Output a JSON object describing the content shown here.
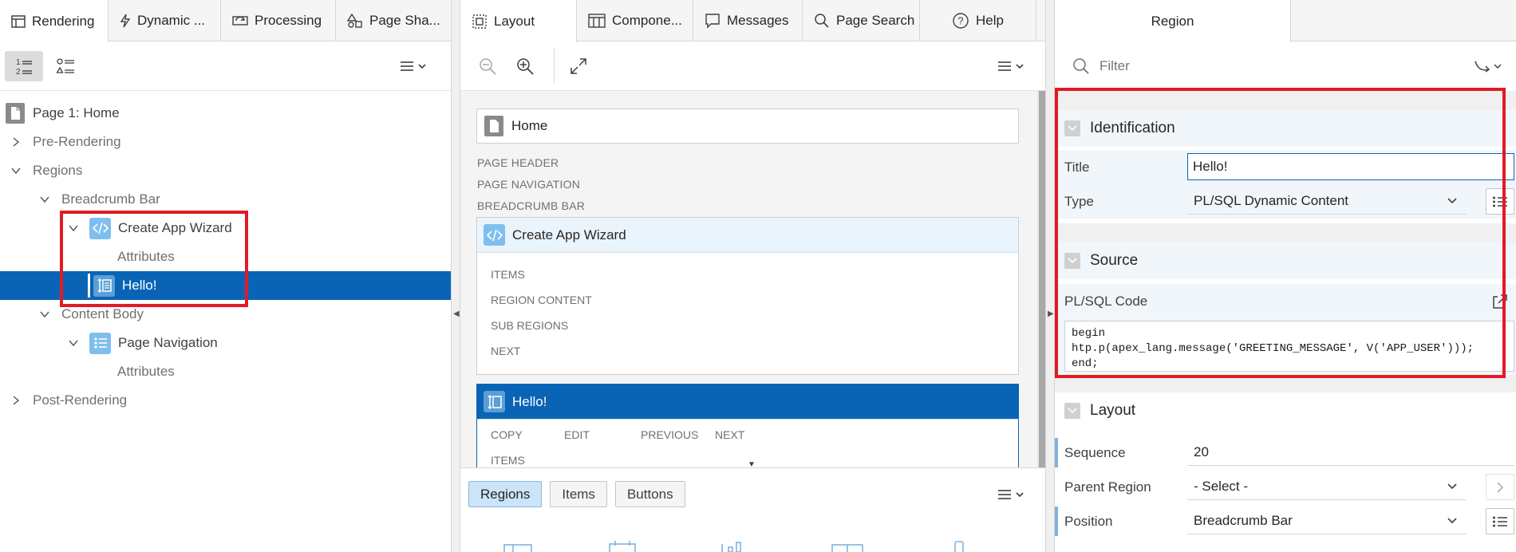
{
  "left": {
    "tabs": [
      "Rendering",
      "Dynamic ...",
      "Processing",
      "Page Sha..."
    ],
    "tree": [
      {
        "label": "Page 1: Home"
      },
      {
        "label": "Pre-Rendering"
      },
      {
        "label": "Regions"
      },
      {
        "label": "Breadcrumb Bar"
      },
      {
        "label": "Create App Wizard"
      },
      {
        "label": "Attributes"
      },
      {
        "label": "Hello!"
      },
      {
        "label": "Content Body"
      },
      {
        "label": "Page Navigation"
      },
      {
        "label": "Attributes"
      },
      {
        "label": "Post-Rendering"
      }
    ]
  },
  "middle": {
    "tabs": [
      "Layout",
      "Compone...",
      "Messages",
      "Page Search",
      "Help"
    ],
    "home_label": "Home",
    "captions": [
      "PAGE HEADER",
      "PAGE NAVIGATION",
      "BREADCRUMB BAR"
    ],
    "region1": {
      "title": "Create App Wizard",
      "subs": [
        "ITEMS",
        "REGION CONTENT",
        "SUB REGIONS",
        "NEXT"
      ]
    },
    "region2": {
      "title": "Hello!",
      "subs": [
        "COPY",
        "EDIT",
        "PREVIOUS",
        "NEXT",
        "ITEMS"
      ]
    },
    "gallery_tabs": [
      "Regions",
      "Items",
      "Buttons"
    ]
  },
  "right": {
    "tab": "Region",
    "filter_placeholder": "Filter",
    "identification": {
      "heading": "Identification",
      "title_label": "Title",
      "title_value": "Hello!",
      "type_label": "Type",
      "type_value": "PL/SQL Dynamic Content"
    },
    "source": {
      "heading": "Source",
      "code_label": "PL/SQL Code",
      "code": "begin\nhtp.p(apex_lang.message('GREETING_MESSAGE', V('APP_USER')));\nend;"
    },
    "layout": {
      "heading": "Layout",
      "sequence_label": "Sequence",
      "sequence_value": "20",
      "parent_label": "Parent Region",
      "parent_value": "- Select -",
      "position_label": "Position",
      "position_value": "Breadcrumb Bar"
    }
  },
  "colors": {
    "selection": "#0a64b6",
    "highlight": "#e01b24",
    "icon": "#7fbfee"
  }
}
